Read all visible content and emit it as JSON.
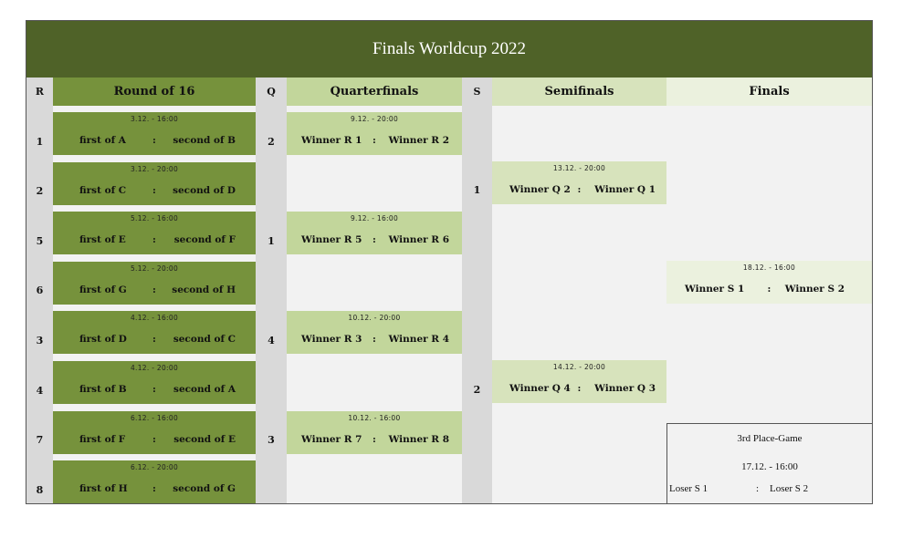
{
  "title": "Finals Worldcup 2022",
  "columns": {
    "r_label": "R",
    "r16_label": "Round of 16",
    "q_label": "Q",
    "qf_label": "Quarterfinals",
    "s_label": "S",
    "sf_label": "Semifinals",
    "f_label": "Finals"
  },
  "separator": ":",
  "round_of_16": [
    {
      "index": "1",
      "time": "3.12. - 16:00",
      "home": "first of A",
      "away": "second of B"
    },
    {
      "index": "2",
      "time": "3.12. - 20:00",
      "home": "first of C",
      "away": "second of D"
    },
    {
      "index": "5",
      "time": "5.12. - 16:00",
      "home": "first of E",
      "away": "second of F"
    },
    {
      "index": "6",
      "time": "5.12. - 20:00",
      "home": "first of G",
      "away": "second of H"
    },
    {
      "index": "3",
      "time": "4.12. - 16:00",
      "home": "first of D",
      "away": "second of C"
    },
    {
      "index": "4",
      "time": "4.12. - 20:00",
      "home": "first of B",
      "away": "second of A"
    },
    {
      "index": "7",
      "time": "6.12. - 16:00",
      "home": "first of F",
      "away": "second of E"
    },
    {
      "index": "8",
      "time": "6.12. - 20:00",
      "home": "first of H",
      "away": "second of G"
    }
  ],
  "quarterfinals": [
    {
      "index": "2",
      "time": "9.12. - 20:00",
      "home": "Winner R 1",
      "away": "Winner R 2"
    },
    {
      "index": "1",
      "time": "9.12. - 16:00",
      "home": "Winner R 5",
      "away": "Winner R 6"
    },
    {
      "index": "4",
      "time": "10.12. - 20:00",
      "home": "Winner R 3",
      "away": "Winner R 4"
    },
    {
      "index": "3",
      "time": "10.12.  - 16:00",
      "home": "Winner R 7",
      "away": "Winner R 8"
    }
  ],
  "semifinals": [
    {
      "index": "1",
      "time": "13.12. - 20:00",
      "home": "Winner Q 2",
      "away": "Winner Q 1"
    },
    {
      "index": "2",
      "time": "14.12. - 20:00",
      "home": "Winner Q 4",
      "away": "Winner Q 3"
    }
  ],
  "final": {
    "time": "18.12. - 16:00",
    "home": "Winner S 1",
    "away": "Winner S 2"
  },
  "third_place": {
    "title": "3rd Place-Game",
    "time": "17.12. - 16:00",
    "home": "Loser S 1",
    "away": "Loser S 2"
  },
  "colors": {
    "title_bar": "#4f6228",
    "round_of_16": "#76923c",
    "quarterfinals": "#c2d69b",
    "semifinals": "#d7e3bc",
    "finals": "#ebf1de",
    "index_column": "#d9d9d9",
    "background": "#f2f2f2"
  }
}
